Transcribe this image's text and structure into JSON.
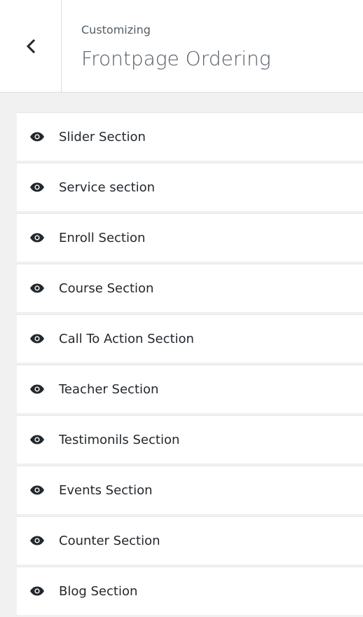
{
  "header": {
    "back_icon": "chevron-left-icon",
    "subtitle": "Customizing",
    "title": "Frontpage Ordering"
  },
  "sections": [
    {
      "label": "Slider Section",
      "icon": "eye-icon"
    },
    {
      "label": "Service section",
      "icon": "eye-icon"
    },
    {
      "label": "Enroll Section",
      "icon": "eye-icon"
    },
    {
      "label": "Course Section",
      "icon": "eye-icon"
    },
    {
      "label": "Call To Action Section",
      "icon": "eye-icon"
    },
    {
      "label": "Teacher Section",
      "icon": "eye-icon"
    },
    {
      "label": "Testimonils Section",
      "icon": "eye-icon"
    },
    {
      "label": "Events Section",
      "icon": "eye-icon"
    },
    {
      "label": "Counter Section",
      "icon": "eye-icon"
    },
    {
      "label": "Blog Section",
      "icon": "eye-icon"
    }
  ]
}
